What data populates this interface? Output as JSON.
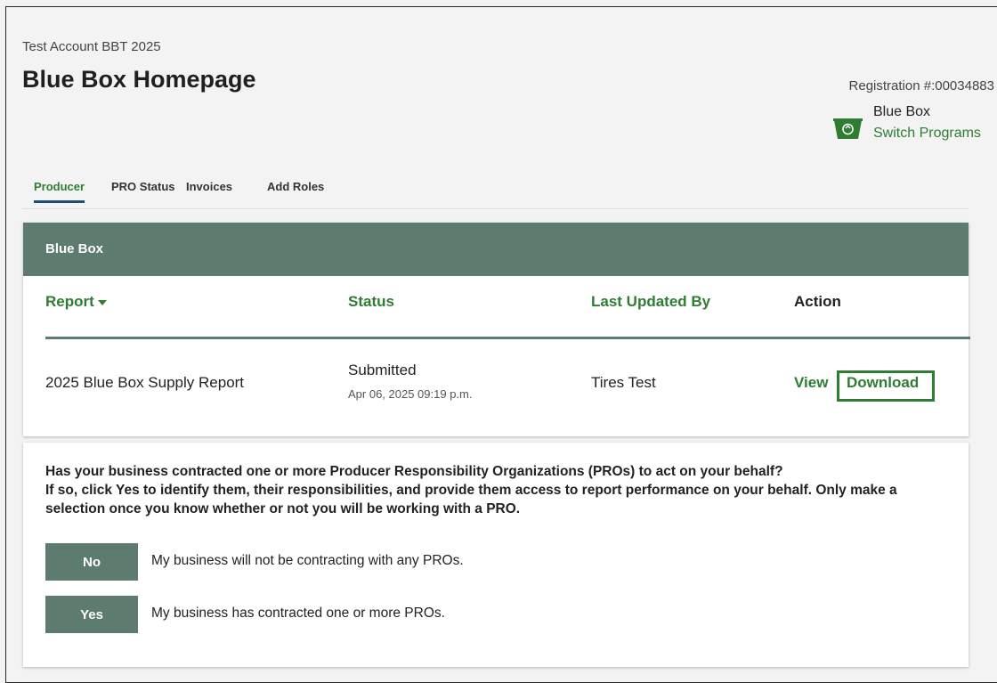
{
  "header": {
    "account_name": "Test Account BBT 2025",
    "title": "Blue Box Homepage",
    "registration": "Registration #:00034883",
    "program_name": "Blue Box",
    "switch_programs": "Switch Programs",
    "program_icon": "recycling-bin-icon"
  },
  "tabs": [
    {
      "label": "Producer",
      "active": true
    },
    {
      "label": "PRO Status",
      "active": false
    },
    {
      "label": "Invoices",
      "active": false
    },
    {
      "label": "Add Roles",
      "active": false
    }
  ],
  "blue_box_card": {
    "title": "Blue Box",
    "columns": [
      "Report",
      "Status",
      "Last Updated By",
      "Action"
    ],
    "rows": [
      {
        "report": "2025 Blue Box Supply Report",
        "status": "Submitted",
        "date": "Apr 06, 2025 09:19 p.m.",
        "updated_by": "Tires Test",
        "actions": [
          "View",
          "Download"
        ]
      }
    ]
  },
  "pro_card": {
    "question_line1": "Has your business contracted one or more Producer Responsibility Organizations (PROs) to act on your behalf?",
    "question_line2": "If so, click Yes to identify them, their responsibilities, and provide them access to report performance on your behalf. Only make a selection once you know whether or not you will be working with a PRO.",
    "options": [
      {
        "button": "No",
        "description": "My business will not be contracting with any PROs."
      },
      {
        "button": "Yes",
        "description": "My business has contracted one or more PROs."
      }
    ]
  },
  "colors": {
    "accent_green": "#2f7d32",
    "header_slate": "#5d7b6f",
    "tab_underline": "#1f4e79"
  }
}
